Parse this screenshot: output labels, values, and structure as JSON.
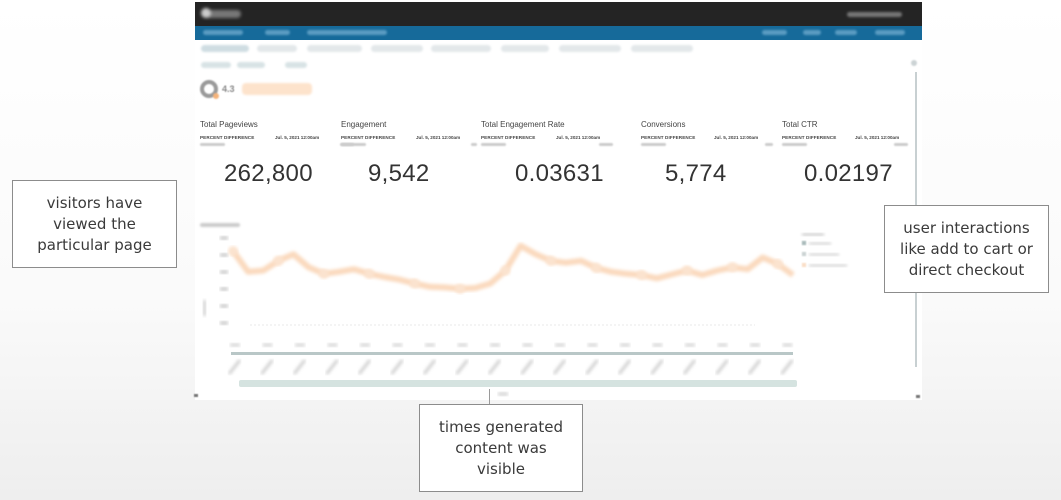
{
  "app": {
    "title": "QuickSight",
    "brand_value": "4.3"
  },
  "kpis": [
    {
      "title": "Total Pageviews",
      "label": "PERCENT DIFFERENCE",
      "date": "Jul. 5, 2021 12:00am",
      "value": "262,800"
    },
    {
      "title": "Engagement",
      "label": "PERCENT DIFFERENCE",
      "date": "Jul. 5, 2021 12:00am",
      "value": "9,542"
    },
    {
      "title": "Total Engagement Rate",
      "label": "PERCENT DIFFERENCE",
      "date": "Jul. 5, 2021 12:00am",
      "value": "0.03631"
    },
    {
      "title": "Conversions",
      "label": "PERCENT DIFFERENCE",
      "date": "Jul. 5, 2021 12:00am",
      "value": "5,774"
    },
    {
      "title": "Total CTR",
      "label": "PERCENT DIFFERENCE",
      "date": "Jul. 5, 2021 12:00am",
      "value": "0.02197"
    }
  ],
  "chart_data": {
    "type": "line",
    "title": "Event Timeline",
    "xlabel": "",
    "ylabel": "",
    "x": [
      1,
      2,
      3,
      4,
      5,
      6,
      7,
      8,
      9,
      10,
      11,
      12,
      13,
      14,
      15,
      16,
      17,
      18,
      19,
      20,
      21,
      22,
      23,
      24,
      25,
      26,
      27,
      28,
      29,
      30,
      31,
      32,
      33,
      34,
      35,
      36,
      37,
      38
    ],
    "series": [
      {
        "name": "Series C",
        "color": "#fad9bd",
        "values": [
          140,
          108,
          110,
          125,
          135,
          115,
          105,
          108,
          112,
          105,
          100,
          96,
          90,
          85,
          84,
          82,
          83,
          90,
          110,
          148,
          135,
          125,
          122,
          125,
          114,
          108,
          105,
          103,
          98,
          104,
          110,
          103,
          110,
          115,
          112,
          130,
          120,
          103
        ]
      }
    ],
    "legend": [
      "Series A",
      "Series B",
      "Series C"
    ],
    "legend_position": "right",
    "ylim": [
      0,
      160
    ],
    "grid": false
  },
  "annotations": {
    "pageviews_note": [
      "visitors have",
      "viewed the",
      "particular page"
    ],
    "engagement_note": [
      "times generated",
      "content was",
      "visible"
    ],
    "conversions_note": [
      "user interactions",
      "like add to cart or",
      "direct checkout"
    ]
  }
}
